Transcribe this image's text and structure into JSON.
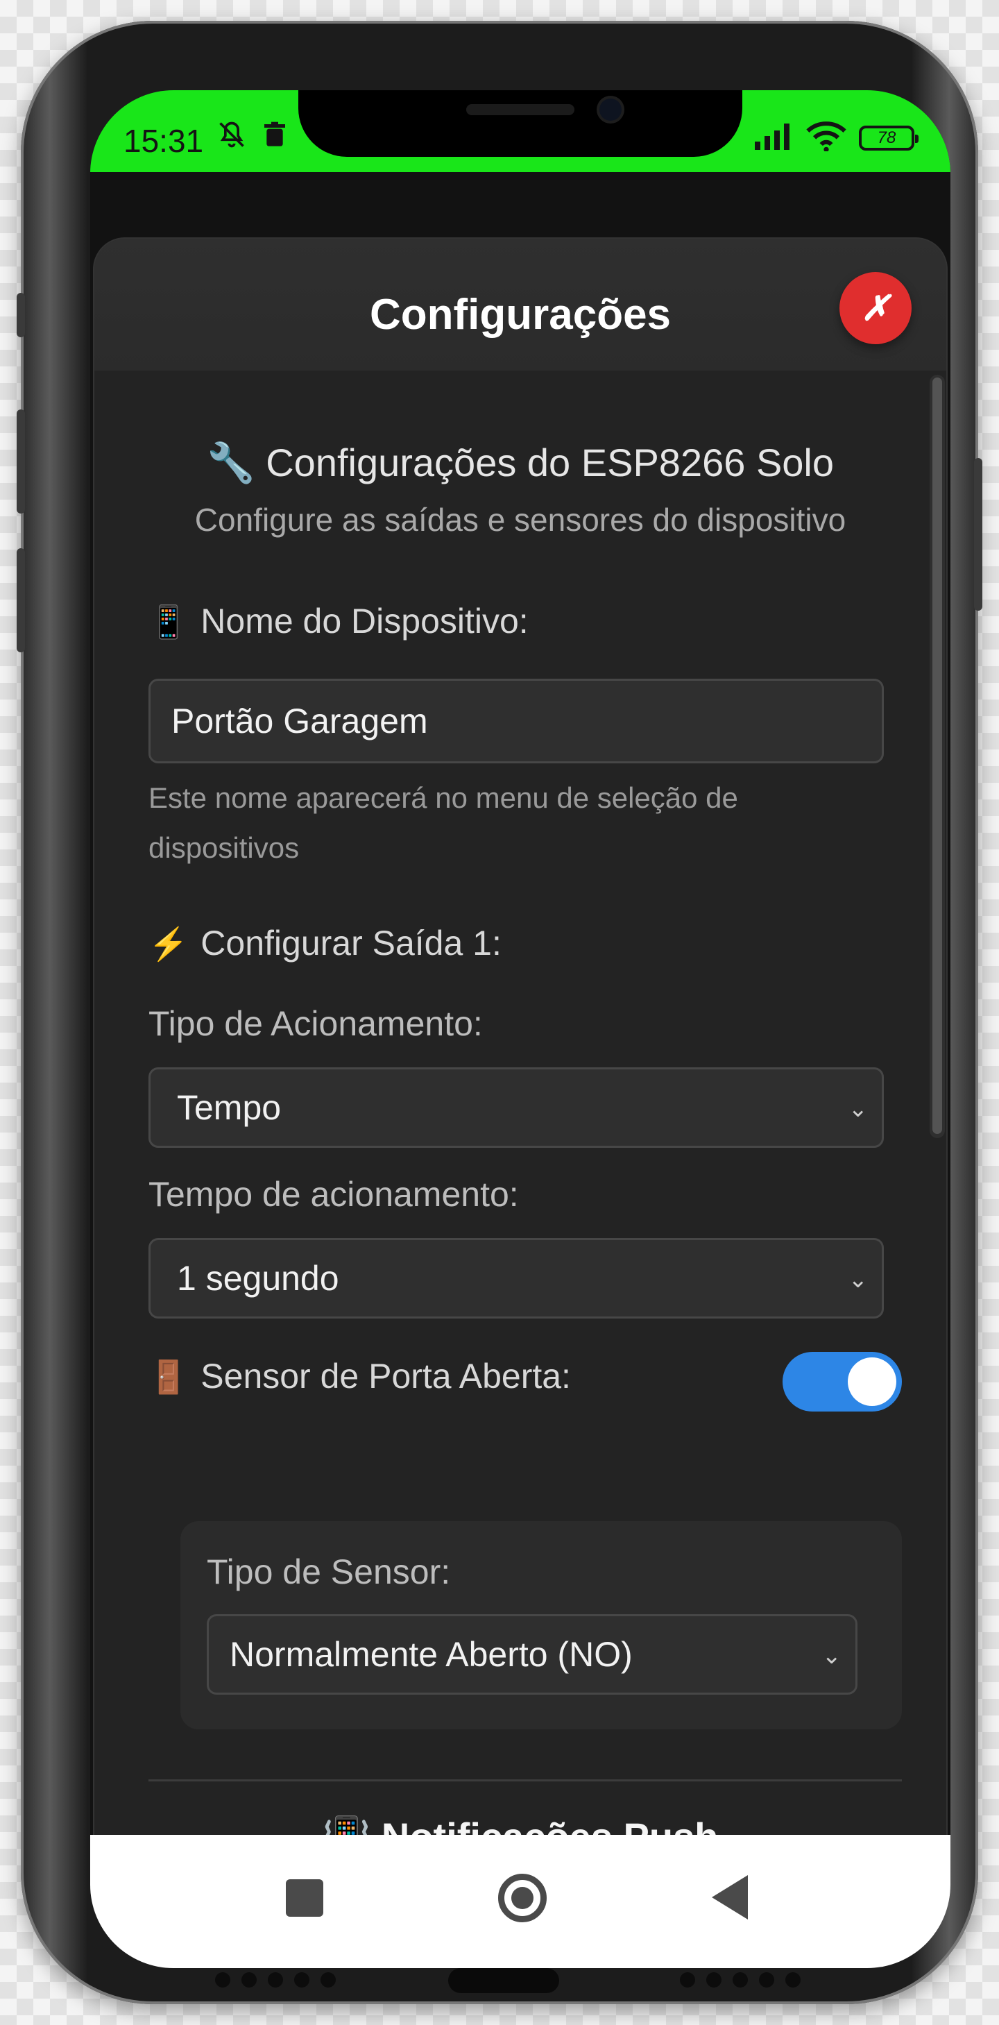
{
  "status_bar": {
    "time": "15:31",
    "left_icons": [
      "bell-off-icon",
      "trash-icon"
    ],
    "right_icons": [
      "signal-icon",
      "wifi-icon"
    ],
    "battery": "78"
  },
  "modal": {
    "title": "Configurações",
    "close_label": "✗",
    "device_title": "🔧 Configurações do ESP8266 Solo",
    "device_subtitle": "Configure as saídas e sensores do dispositivo",
    "name_section": {
      "emoji": "📱",
      "label": "Nome do Dispositivo:",
      "value": "Portão Garagem",
      "help": "Este nome aparecerá no menu de seleção de dispositivos"
    },
    "output_section": {
      "emoji": "⚡",
      "label": "Configurar Saída 1:",
      "type_label": "Tipo de Acionamento:",
      "type_value": "Tempo",
      "time_label": "Tempo de acionamento:",
      "time_value": "1 segundo"
    },
    "sensor_section": {
      "emoji": "🚪",
      "label": "Sensor de Porta Aberta:",
      "enabled": true,
      "type_label": "Tipo de Sensor:",
      "type_value": "Normalmente Aberto (NO)"
    },
    "push_title": "📳 Notificações Push"
  },
  "colors": {
    "status_bar": "#19e619",
    "modal_bg": "#262626",
    "close_button": "#e02e2e",
    "toggle_on": "#2d86e6"
  }
}
